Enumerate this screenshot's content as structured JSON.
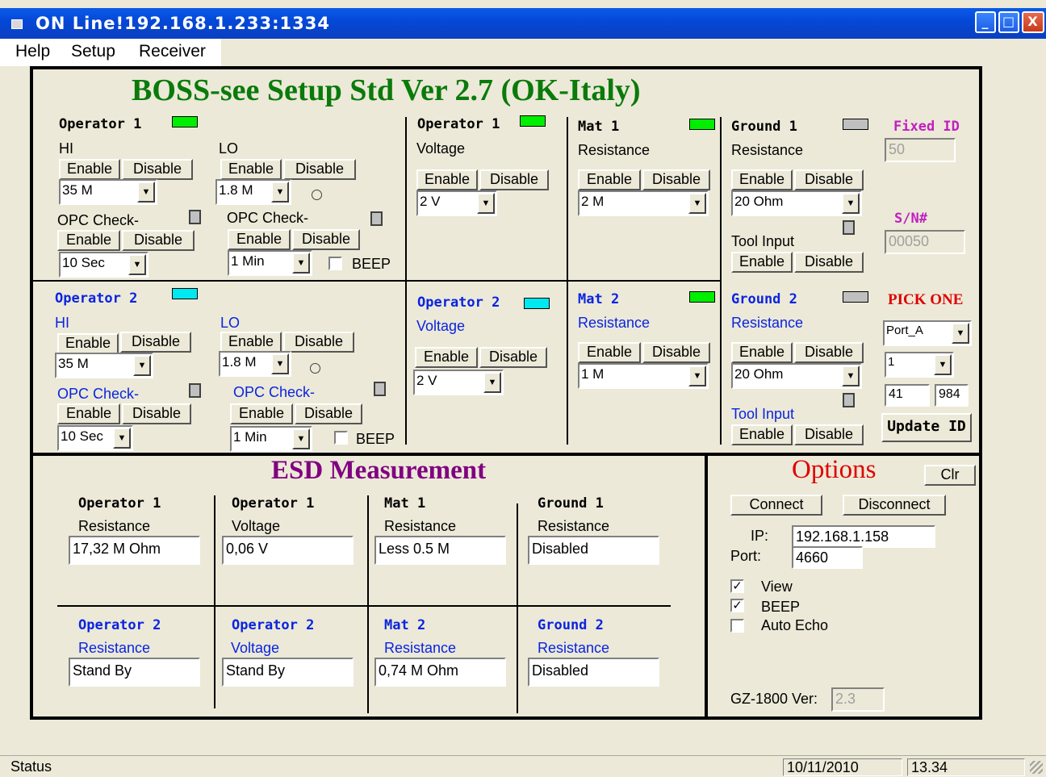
{
  "window": {
    "title": "ON Line!192.168.1.233:1334",
    "icon": "app-icon",
    "buttons": {
      "min": "_",
      "max": "□",
      "close": "X"
    }
  },
  "menu": [
    "Help",
    "Setup",
    "Receiver"
  ],
  "setup": {
    "title": "BOSS-see Setup Std Ver 2.7 (OK-Italy)",
    "enable": "Enable",
    "disable": "Disable",
    "op1": {
      "name": "Operator 1",
      "led": "#00ee00",
      "hi": "HI",
      "lo": "LO",
      "hi_val": "35 M",
      "lo_val": "1.8 M",
      "opc": "OPC Check-",
      "opc_hi_val": "10 Sec",
      "opc_lo_val": "1 Min",
      "beep": "BEEP"
    },
    "op2": {
      "name": "Operator 2",
      "led": "#00e8f0",
      "hi": "HI",
      "lo": "LO",
      "hi_val": "35 M",
      "lo_val": "1.8 M",
      "opc": "OPC Check-",
      "opc_hi_val": "10 Sec",
      "opc_lo_val": "1 Min",
      "beep": "BEEP"
    },
    "op1v": {
      "name": "Operator 1",
      "label": "Voltage",
      "val": "2 V",
      "led": "#00ee00"
    },
    "op2v": {
      "name": "Operator 2",
      "label": "Voltage",
      "val": "2 V",
      "led": "#00e8f0"
    },
    "mat1": {
      "name": "Mat 1",
      "label": "Resistance",
      "val": "2 M",
      "led": "#00ee00"
    },
    "mat2": {
      "name": "Mat 2",
      "label": "Resistance",
      "val": "1 M",
      "led": "#00ee00"
    },
    "gnd1": {
      "name": "Ground 1",
      "label": "Resistance",
      "val": "20 Ohm",
      "tool": "Tool Input",
      "led": "#c0c0c0"
    },
    "gnd2": {
      "name": "Ground 2",
      "label": "Resistance",
      "val": "20 Ohm",
      "tool": "Tool Input",
      "led": "#c0c0c0"
    },
    "fixed_id": {
      "label": "Fixed ID",
      "val": "50"
    },
    "sn": {
      "label": "S/N#",
      "val": "00050"
    },
    "pick": {
      "label": "PICK ONE",
      "port": "Port_A",
      "num": "1",
      "a": "41",
      "b": "984",
      "update": "Update ID"
    }
  },
  "esd": {
    "title": "ESD Measurement",
    "row1": [
      {
        "name": "Operator 1",
        "label": "Resistance",
        "val": "17,32 M Ohm"
      },
      {
        "name": "Operator 1",
        "label": "Voltage",
        "val": "0,06 V"
      },
      {
        "name": "Mat 1",
        "label": "Resistance",
        "val": "Less 0.5 M"
      },
      {
        "name": "Ground 1",
        "label": "Resistance",
        "val": "Disabled"
      }
    ],
    "row2": [
      {
        "name": "Operator 2",
        "label": "Resistance",
        "val": "Stand By"
      },
      {
        "name": "Operator 2",
        "label": "Voltage",
        "val": "Stand By"
      },
      {
        "name": "Mat 2",
        "label": "Resistance",
        "val": "0,74 M Ohm"
      },
      {
        "name": "Ground 2",
        "label": "Resistance",
        "val": "Disabled"
      }
    ]
  },
  "options": {
    "title": "Options",
    "clr": "Clr",
    "connect": "Connect",
    "disconnect": "Disconnect",
    "ip_label": "IP:",
    "ip": "192.168.1.158",
    "port_label": "Port:",
    "port": "4660",
    "view": "View",
    "view_checked": true,
    "beep": "BEEP",
    "beep_checked": true,
    "auto_echo": "Auto Echo",
    "auto_checked": false,
    "ver_label": "GZ-1800 Ver:",
    "ver": "2.3"
  },
  "status": {
    "text": "Status",
    "date": "10/11/2010",
    "time": "13.34"
  }
}
